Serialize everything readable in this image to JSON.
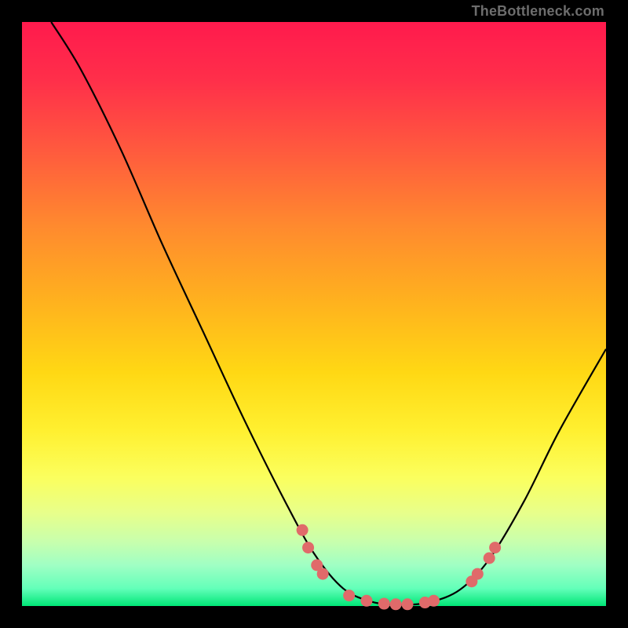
{
  "attribution": "TheBottleneck.com",
  "colors": {
    "dot_fill": "#e06a6a",
    "dot_stroke": "#c23d3d",
    "curve": "#000000"
  },
  "chart_data": {
    "type": "line",
    "title": "",
    "xlabel": "",
    "ylabel": "",
    "xlim": [
      0,
      100
    ],
    "ylim": [
      0,
      100
    ],
    "grid": false,
    "curve_points": [
      {
        "x": 5,
        "y": 100
      },
      {
        "x": 10,
        "y": 92
      },
      {
        "x": 17,
        "y": 78
      },
      {
        "x": 24,
        "y": 62
      },
      {
        "x": 31,
        "y": 47
      },
      {
        "x": 38,
        "y": 32
      },
      {
        "x": 45,
        "y": 18
      },
      {
        "x": 50,
        "y": 9
      },
      {
        "x": 55,
        "y": 3
      },
      {
        "x": 60,
        "y": 0.7
      },
      {
        "x": 65,
        "y": 0.2
      },
      {
        "x": 70,
        "y": 0.7
      },
      {
        "x": 75,
        "y": 2.8
      },
      {
        "x": 80,
        "y": 8
      },
      {
        "x": 86,
        "y": 18
      },
      {
        "x": 92,
        "y": 30
      },
      {
        "x": 100,
        "y": 44
      }
    ],
    "dots": [
      {
        "x": 48,
        "y": 13
      },
      {
        "x": 49,
        "y": 10
      },
      {
        "x": 50.5,
        "y": 7
      },
      {
        "x": 51.5,
        "y": 5.5
      },
      {
        "x": 56,
        "y": 1.8
      },
      {
        "x": 59,
        "y": 0.9
      },
      {
        "x": 62,
        "y": 0.4
      },
      {
        "x": 64,
        "y": 0.3
      },
      {
        "x": 66,
        "y": 0.3
      },
      {
        "x": 69,
        "y": 0.6
      },
      {
        "x": 70.5,
        "y": 0.9
      },
      {
        "x": 77,
        "y": 4.2
      },
      {
        "x": 78,
        "y": 5.5
      },
      {
        "x": 80,
        "y": 8.2
      },
      {
        "x": 81,
        "y": 10
      }
    ]
  }
}
